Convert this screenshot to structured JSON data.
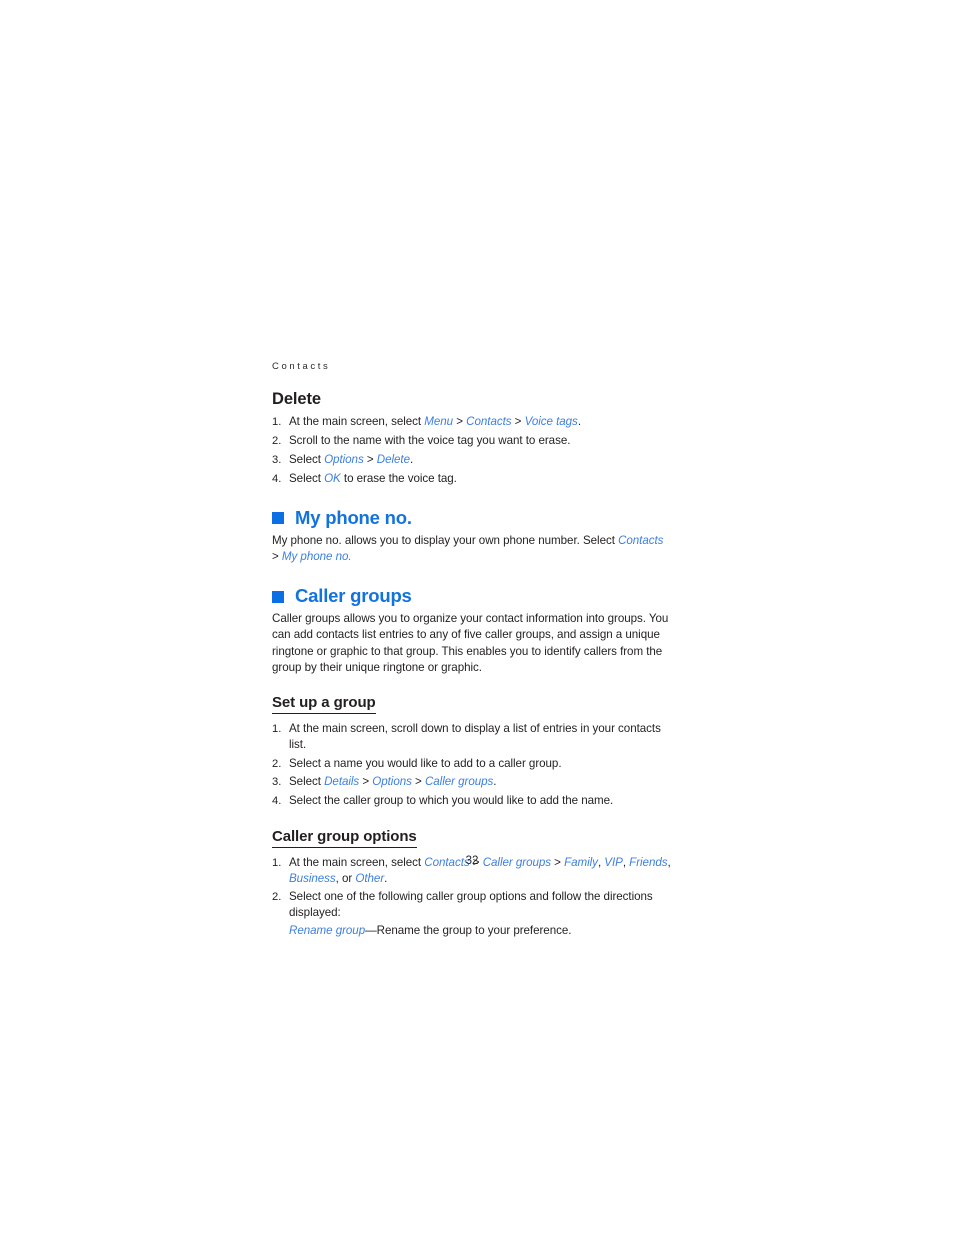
{
  "running_header": "Contacts",
  "page_number": "32",
  "colors": {
    "heading_blue": "#1272e0",
    "bullet_blue": "#0a6ee4",
    "link_blue": "#3d7fe0",
    "body_text": "#231f20"
  },
  "sections": {
    "delete": {
      "heading": "Delete",
      "steps": [
        {
          "pre": "At the main screen, select ",
          "refs": [
            "Menu",
            "Contacts",
            "Voice tags"
          ],
          "post": "."
        },
        {
          "full": "Scroll to the name with the voice tag you want to erase."
        },
        {
          "pre": "Select ",
          "refs": [
            "Options",
            "Delete"
          ],
          "post": "."
        },
        {
          "pre": "Select ",
          "refs": [
            "OK"
          ],
          "post": " to erase the voice tag."
        }
      ]
    },
    "my_phone_no": {
      "heading": "My phone no.",
      "bullet_icon": "blue-square-bullet",
      "paragraph_pre": "My phone no. allows you to display your own phone number. Select ",
      "paragraph_ref1": "Contacts",
      "paragraph_sep": " > ",
      "paragraph_ref2": "My phone no.",
      "paragraph_post": ""
    },
    "caller_groups": {
      "heading": "Caller groups",
      "bullet_icon": "blue-square-bullet",
      "intro": "Caller groups allows you to organize your contact information into groups. You can add contacts list entries to any of five caller groups, and assign a unique ringtone or graphic to that group. This enables you to identify callers from the group by their unique ringtone or graphic.",
      "set_up_a_group": {
        "heading": "Set up a group",
        "steps": [
          {
            "full": "At the main screen, scroll down to display a list of entries in your contacts list."
          },
          {
            "full": "Select a name you would like to add to a caller group."
          },
          {
            "pre": "Select ",
            "refs": [
              "Details",
              "Options",
              "Caller groups"
            ],
            "post": "."
          },
          {
            "full": "Select the caller group to which you would like to add the name."
          }
        ]
      },
      "caller_group_options": {
        "heading": "Caller group options",
        "step1_pre": "At the main screen, select ",
        "step1_ref_contacts": "Contacts",
        "step1_ref_caller_groups": "Caller groups",
        "step1_ref_family": "Family",
        "step1_ref_vip": "VIP",
        "step1_ref_friends": "Friends",
        "step1_ref_business": "Business",
        "step1_or": ", or ",
        "step1_ref_other": "Other",
        "step1_end": ".",
        "step2_text": "Select one of the following caller group options and follow the directions displayed:",
        "step2_sub_ref": "Rename group",
        "step2_sub_text": "—Rename the group to your preference."
      }
    }
  }
}
